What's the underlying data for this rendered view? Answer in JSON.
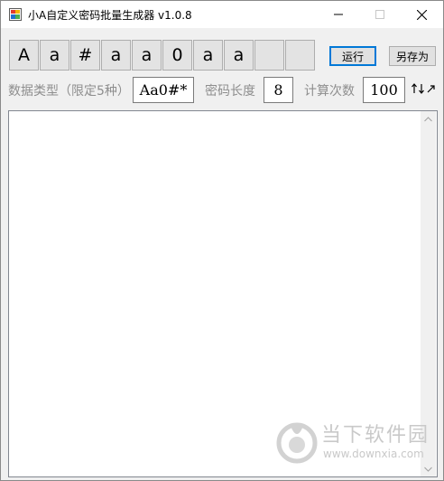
{
  "window": {
    "title": "小A自定义密码批量生成器 v1.0.8"
  },
  "char_slots": [
    "A",
    "a",
    "#",
    "a",
    "a",
    "0",
    "a",
    "a",
    "",
    ""
  ],
  "buttons": {
    "run": "运行",
    "save_as": "另存为"
  },
  "settings": {
    "type_label": "数据类型（限定5种）",
    "type_value": "Aa0#*",
    "length_label": "密码长度",
    "length_value": "8",
    "count_label": "计算次数",
    "count_value": "100"
  },
  "output": {
    "text": ""
  },
  "watermark": {
    "name": "当下软件园",
    "url": "www.downxia.com"
  },
  "icons": {
    "app": "app-icon",
    "sort": "sort-arrows-icon"
  }
}
